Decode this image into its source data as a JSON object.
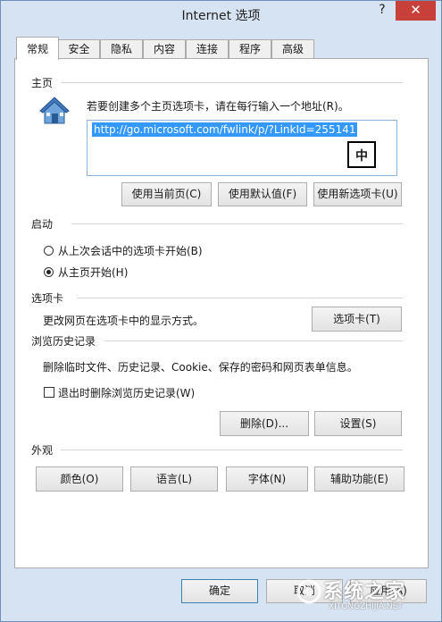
{
  "window": {
    "title": "Internet 选项",
    "help": "?",
    "close": "✕"
  },
  "tabs": [
    {
      "label": "常规",
      "active": true
    },
    {
      "label": "安全"
    },
    {
      "label": "隐私"
    },
    {
      "label": "内容"
    },
    {
      "label": "连接"
    },
    {
      "label": "程序"
    },
    {
      "label": "高级"
    }
  ],
  "home": {
    "title": "主页",
    "instruction": "若要创建多个主页选项卡，请在每行输入一个地址(R)。",
    "url": "http://go.microsoft.com/fwlink/p/?LinkId=255141",
    "ime_indicator": "中",
    "buttons": {
      "use_current": "使用当前页(C)",
      "use_default": "使用默认值(F)",
      "use_new_tab": "使用新选项卡(U)"
    }
  },
  "startup": {
    "title": "启动",
    "options": [
      {
        "label": "从上次会话中的选项卡开始(B)",
        "selected": false
      },
      {
        "label": "从主页开始(H)",
        "selected": true
      }
    ]
  },
  "tabs_section": {
    "title": "选项卡",
    "description": "更改网页在选项卡中的显示方式。",
    "button": "选项卡(T)"
  },
  "history": {
    "title": "浏览历史记录",
    "description": "删除临时文件、历史记录、Cookie、保存的密码和网页表单信息。",
    "checkbox_label": "退出时删除浏览历史记录(W)",
    "checkbox_checked": false,
    "buttons": {
      "delete": "删除(D)...",
      "settings": "设置(S)"
    }
  },
  "appearance": {
    "title": "外观",
    "buttons": {
      "colors": "颜色(O)",
      "languages": "语言(L)",
      "fonts": "字体(N)",
      "accessibility": "辅助功能(E)"
    }
  },
  "footer": {
    "ok": "确定",
    "cancel": "取消",
    "apply": "应用(A)"
  },
  "watermark": {
    "brand": "系统之家",
    "url": "XITONGZHIJIA.NET"
  },
  "colors": {
    "frame": "#d6e3f2",
    "close_button": "#c7413a",
    "selection": "#3399ff"
  }
}
